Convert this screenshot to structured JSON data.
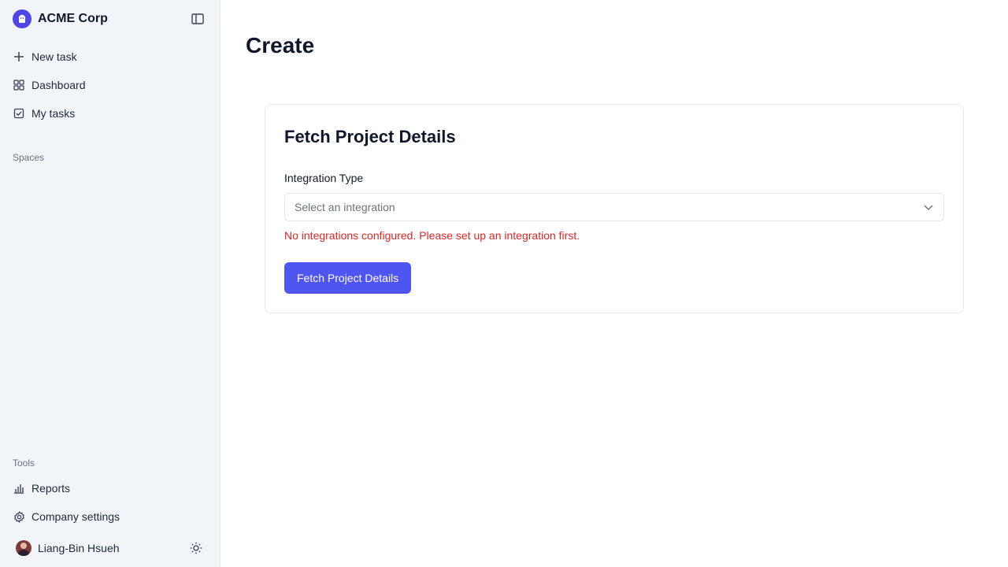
{
  "sidebar": {
    "brand_name": "ACME Corp",
    "nav": [
      {
        "label": "New task",
        "icon": "plus-icon"
      },
      {
        "label": "Dashboard",
        "icon": "grid-icon"
      },
      {
        "label": "My tasks",
        "icon": "checkbox-icon"
      }
    ],
    "spaces_label": "Spaces",
    "tools_label": "Tools",
    "tools": [
      {
        "label": "Reports",
        "icon": "bar-chart-icon"
      },
      {
        "label": "Company settings",
        "icon": "gear-icon"
      }
    ],
    "user_name": "Liang-Bin Hsueh"
  },
  "main": {
    "page_title": "Create",
    "card": {
      "title": "Fetch Project Details",
      "field_label": "Integration Type",
      "select_placeholder": "Select an integration",
      "error": "No integrations configured. Please set up an integration first.",
      "button_label": "Fetch Project Details"
    }
  },
  "colors": {
    "accent": "#4f55f1",
    "error": "#dc2626",
    "sidebar_bg": "#f1f4f9"
  }
}
